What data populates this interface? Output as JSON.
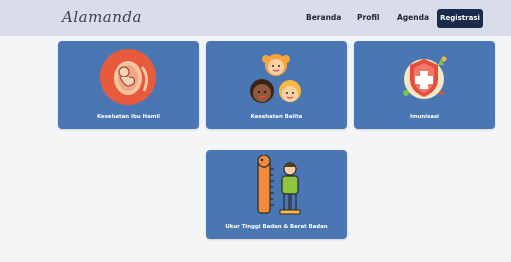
{
  "navbar": {
    "brand": "Alamanda",
    "links": [
      "Beranda",
      "Profil",
      "Agenda"
    ],
    "cta": "Registrasi"
  },
  "cards": [
    {
      "label": "Kesehatan Ibu Hamil",
      "icon": "pregnancy-icon"
    },
    {
      "label": "Kesehatan Balita",
      "icon": "children-icon"
    },
    {
      "label": "Imunisasi",
      "icon": "health-shield-icon"
    },
    {
      "label": "Ukur Tinggi Badan & Berat Badan",
      "icon": "height-measure-icon"
    }
  ],
  "colors": {
    "navbar_bg": "#d8dde9",
    "card_bg": "#4a77b4",
    "cta_bg": "#1a2a4a",
    "page_bg": "#f4f5f7"
  }
}
